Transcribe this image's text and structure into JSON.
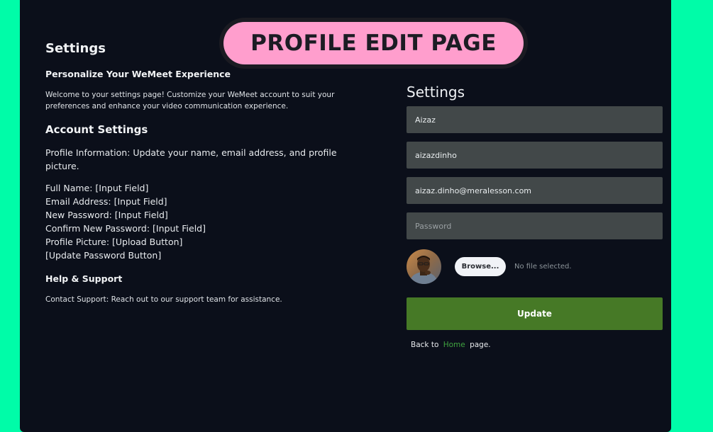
{
  "banner": {
    "label": "PROFILE EDIT PAGE"
  },
  "left": {
    "title": "Settings",
    "subtitle": "Personalize Your WeMeet Experience",
    "intro": "Welcome to your settings page! Customize your WeMeet account to suit your preferences and enhance your video communication experience.",
    "account_heading": "Account Settings",
    "profile_info": "Profile Information: Update your name, email address, and profile picture.",
    "fields": [
      "Full Name: [Input Field]",
      "Email Address: [Input Field]",
      "New Password: [Input Field]",
      "Confirm New Password: [Input Field]",
      "Profile Picture: [Upload Button]",
      "[Update Password Button]"
    ],
    "help_heading": "Help & Support",
    "contact": "Contact Support: Reach out to our support team for assistance."
  },
  "form": {
    "title": "Settings",
    "name_value": "Aizaz",
    "username_value": "aizazdinho",
    "email_value": "aizaz.dinho@meralesson.com",
    "password_placeholder": "Password",
    "browse_label": "Browse...",
    "no_file_text": "No file selected.",
    "update_label": "Update",
    "back_prefix": "Back to",
    "home_link": "Home",
    "back_suffix": "page."
  },
  "colors": {
    "background": "#00fca8",
    "panel": "#0b0f1a",
    "banner": "#ff9ecd",
    "input": "#424849",
    "update_button": "#467926",
    "link": "#3fa33f"
  }
}
